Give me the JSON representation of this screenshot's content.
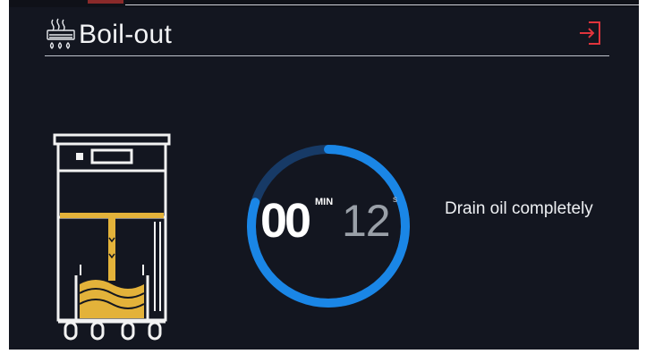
{
  "header": {
    "title": "Boil-out",
    "icon": "boil-out-icon",
    "exit_icon": "exit-icon"
  },
  "timer": {
    "minutes": "00",
    "minutes_label": "MIN",
    "seconds": "12",
    "seconds_label": "s",
    "progress": 0.8
  },
  "instruction": "Drain oil completely",
  "colors": {
    "background": "#131620",
    "ring_active": "#1a86e6",
    "ring_track": "#173a66",
    "exit_accent": "#e0343c",
    "oil": "#e3b23a"
  }
}
